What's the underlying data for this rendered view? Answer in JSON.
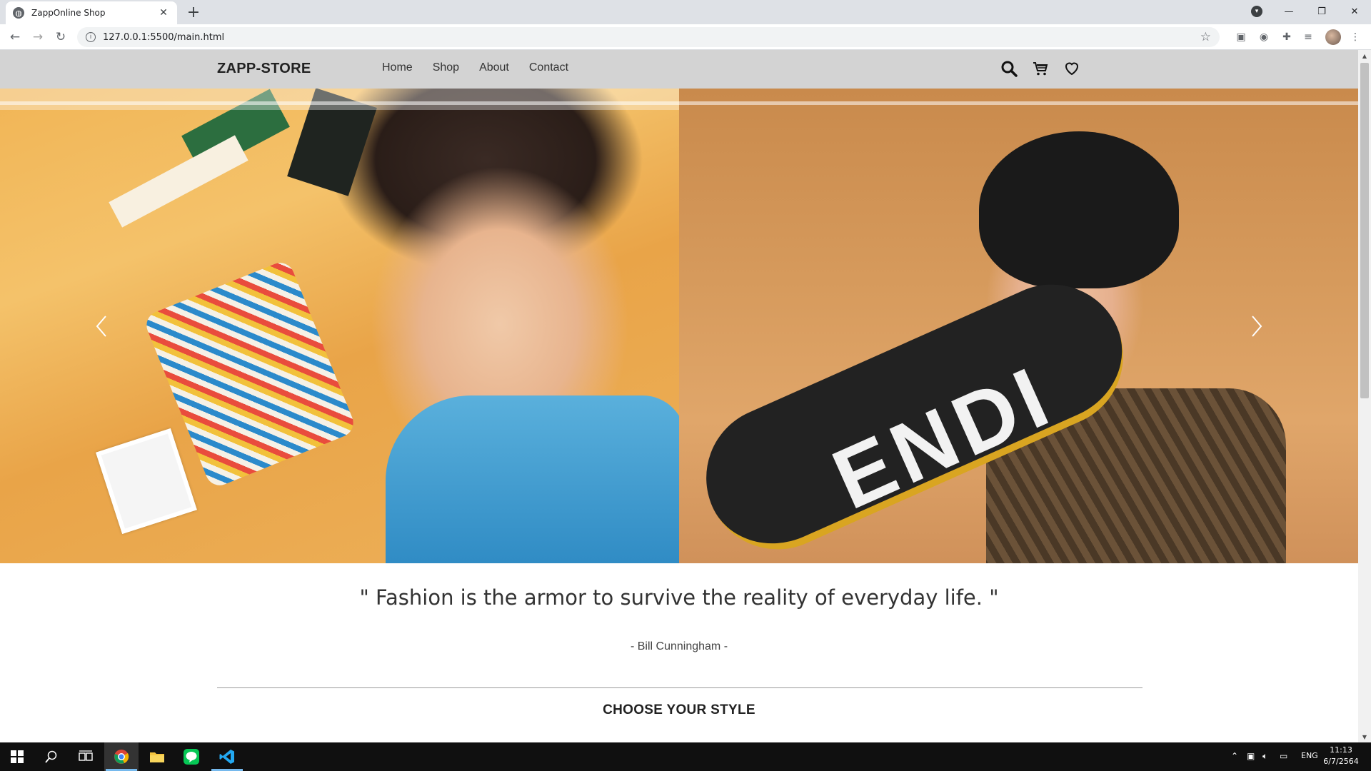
{
  "browser": {
    "tab_title": "ZappOnline Shop",
    "tab_close": "✕",
    "new_tab": "+",
    "url": "127.0.0.1:5500/main.html",
    "window_controls": {
      "minimize": "—",
      "restore": "❐",
      "close": "✕"
    }
  },
  "site": {
    "logo": "ZAPP-STORE",
    "nav": [
      "Home",
      "Shop",
      "About",
      "Contact"
    ],
    "icons": [
      "search-icon",
      "cart-icon",
      "heart-icon"
    ]
  },
  "hero": {
    "right_board_text": "ENDI"
  },
  "quote": {
    "text": "\" Fashion is the armor to survive the reality of everyday life. \"",
    "author": "- Bill Cunningham -"
  },
  "section": {
    "title": "CHOOSE YOUR STYLE"
  },
  "taskbar": {
    "language": "ENG",
    "time": "11:13",
    "date": "6/7/2564"
  },
  "colors": {
    "header_bg": "#d3d3d3",
    "chrome_tabbar": "#dee1e6",
    "taskbar": "#101010"
  }
}
